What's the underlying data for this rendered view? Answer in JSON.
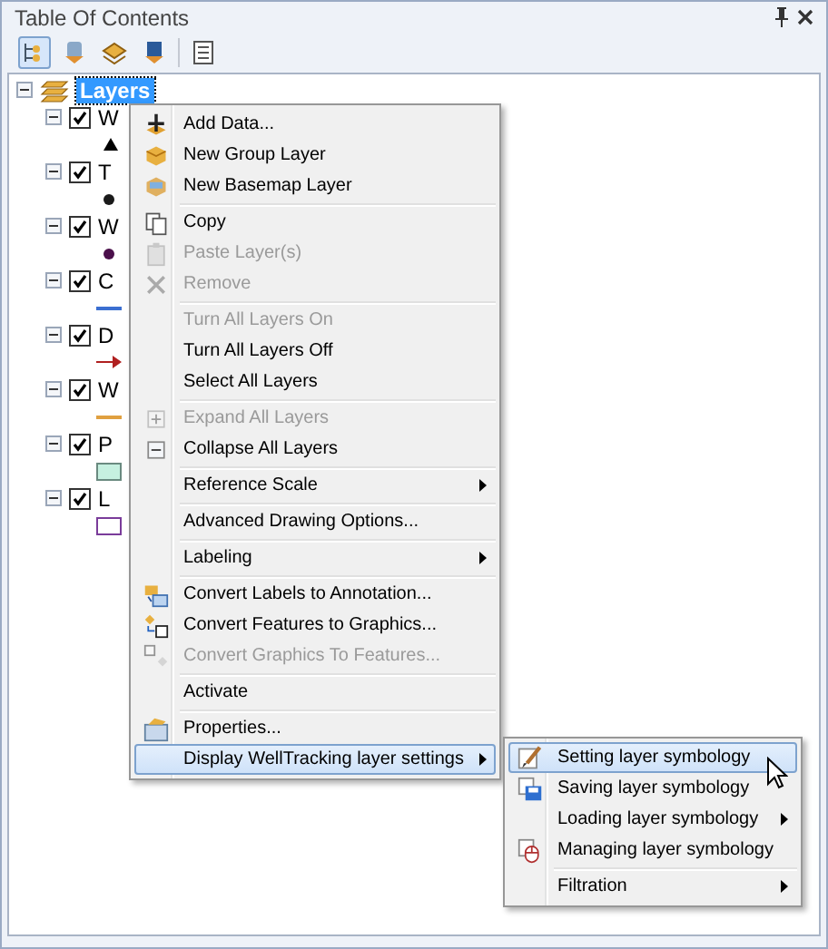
{
  "panel": {
    "title": "Table Of Contents"
  },
  "toolbar": [
    {
      "selected": true
    },
    {
      "selected": false
    },
    {
      "selected": false
    },
    {
      "selected": false
    },
    {
      "selected": false
    }
  ],
  "tree": {
    "root": {
      "label": "Layers",
      "selected": true,
      "expanded": true
    },
    "layers": [
      {
        "name": "W",
        "checked": true,
        "expanded": true,
        "symbol": {
          "kind": "triangle",
          "color": "#000000"
        }
      },
      {
        "name": "T",
        "checked": true,
        "expanded": true,
        "symbol": {
          "kind": "dot",
          "color": "#1a1a1a"
        }
      },
      {
        "name": "W",
        "checked": true,
        "expanded": true,
        "symbol": {
          "kind": "dot",
          "color": "#4b0f4b"
        }
      },
      {
        "name": "C",
        "checked": true,
        "expanded": true,
        "symbol": {
          "kind": "line",
          "color": "#3b6fd1"
        }
      },
      {
        "name": "D",
        "checked": true,
        "expanded": true,
        "symbol": {
          "kind": "arrow",
          "color": "#b02020"
        }
      },
      {
        "name": "W",
        "checked": true,
        "expanded": true,
        "symbol": {
          "kind": "line",
          "color": "#e0a040"
        }
      },
      {
        "name": "P",
        "checked": true,
        "expanded": true,
        "symbol": {
          "kind": "fill",
          "color": "#c6f0e0"
        }
      },
      {
        "name": "L",
        "checked": true,
        "expanded": true,
        "symbol": {
          "kind": "outline",
          "color": "#7a3c9a"
        }
      }
    ]
  },
  "menu": {
    "items": [
      {
        "kind": "item",
        "label": "Add Data...",
        "disabled": false,
        "submenu": false,
        "selected": false
      },
      {
        "kind": "item",
        "label": "New Group Layer",
        "disabled": false,
        "submenu": false,
        "selected": false
      },
      {
        "kind": "item",
        "label": "New Basemap Layer",
        "disabled": false,
        "submenu": false,
        "selected": false
      },
      {
        "kind": "separator"
      },
      {
        "kind": "item",
        "label": "Copy",
        "disabled": false,
        "submenu": false,
        "selected": false
      },
      {
        "kind": "item",
        "label": "Paste Layer(s)",
        "disabled": true,
        "submenu": false,
        "selected": false
      },
      {
        "kind": "item",
        "label": "Remove",
        "disabled": true,
        "submenu": false,
        "selected": false
      },
      {
        "kind": "separator"
      },
      {
        "kind": "item",
        "label": "Turn All Layers On",
        "disabled": true,
        "submenu": false,
        "selected": false
      },
      {
        "kind": "item",
        "label": "Turn All Layers Off",
        "disabled": false,
        "submenu": false,
        "selected": false
      },
      {
        "kind": "item",
        "label": "Select All Layers",
        "disabled": false,
        "submenu": false,
        "selected": false
      },
      {
        "kind": "separator"
      },
      {
        "kind": "item",
        "label": "Expand All Layers",
        "disabled": true,
        "submenu": false,
        "selected": false
      },
      {
        "kind": "item",
        "label": "Collapse All Layers",
        "disabled": false,
        "submenu": false,
        "selected": false
      },
      {
        "kind": "separator"
      },
      {
        "kind": "item",
        "label": "Reference Scale",
        "disabled": false,
        "submenu": true,
        "selected": false
      },
      {
        "kind": "separator"
      },
      {
        "kind": "item",
        "label": "Advanced Drawing Options...",
        "disabled": false,
        "submenu": false,
        "selected": false
      },
      {
        "kind": "separator"
      },
      {
        "kind": "item",
        "label": "Labeling",
        "disabled": false,
        "submenu": true,
        "selected": false
      },
      {
        "kind": "separator"
      },
      {
        "kind": "item",
        "label": "Convert Labels to Annotation...",
        "disabled": false,
        "submenu": false,
        "selected": false
      },
      {
        "kind": "item",
        "label": "Convert Features to Graphics...",
        "disabled": false,
        "submenu": false,
        "selected": false
      },
      {
        "kind": "item",
        "label": "Convert Graphics To Features...",
        "disabled": true,
        "submenu": false,
        "selected": false
      },
      {
        "kind": "separator"
      },
      {
        "kind": "item",
        "label": "Activate",
        "disabled": false,
        "submenu": false,
        "selected": false
      },
      {
        "kind": "separator"
      },
      {
        "kind": "item",
        "label": "Properties...",
        "disabled": false,
        "submenu": false,
        "selected": false
      },
      {
        "kind": "item",
        "label": "Display WellTracking layer settings",
        "disabled": false,
        "submenu": true,
        "selected": true
      }
    ]
  },
  "submenu": {
    "items": [
      {
        "kind": "item",
        "label": "Setting layer symbology",
        "disabled": false,
        "submenu": false,
        "selected": true
      },
      {
        "kind": "item",
        "label": "Saving layer symbology",
        "disabled": false,
        "submenu": false,
        "selected": false
      },
      {
        "kind": "item",
        "label": "Loading layer symbology",
        "disabled": false,
        "submenu": true,
        "selected": false
      },
      {
        "kind": "item",
        "label": "Managing layer symbology",
        "disabled": false,
        "submenu": false,
        "selected": false
      },
      {
        "kind": "separator"
      },
      {
        "kind": "item",
        "label": "Filtration",
        "disabled": false,
        "submenu": true,
        "selected": false
      }
    ]
  }
}
